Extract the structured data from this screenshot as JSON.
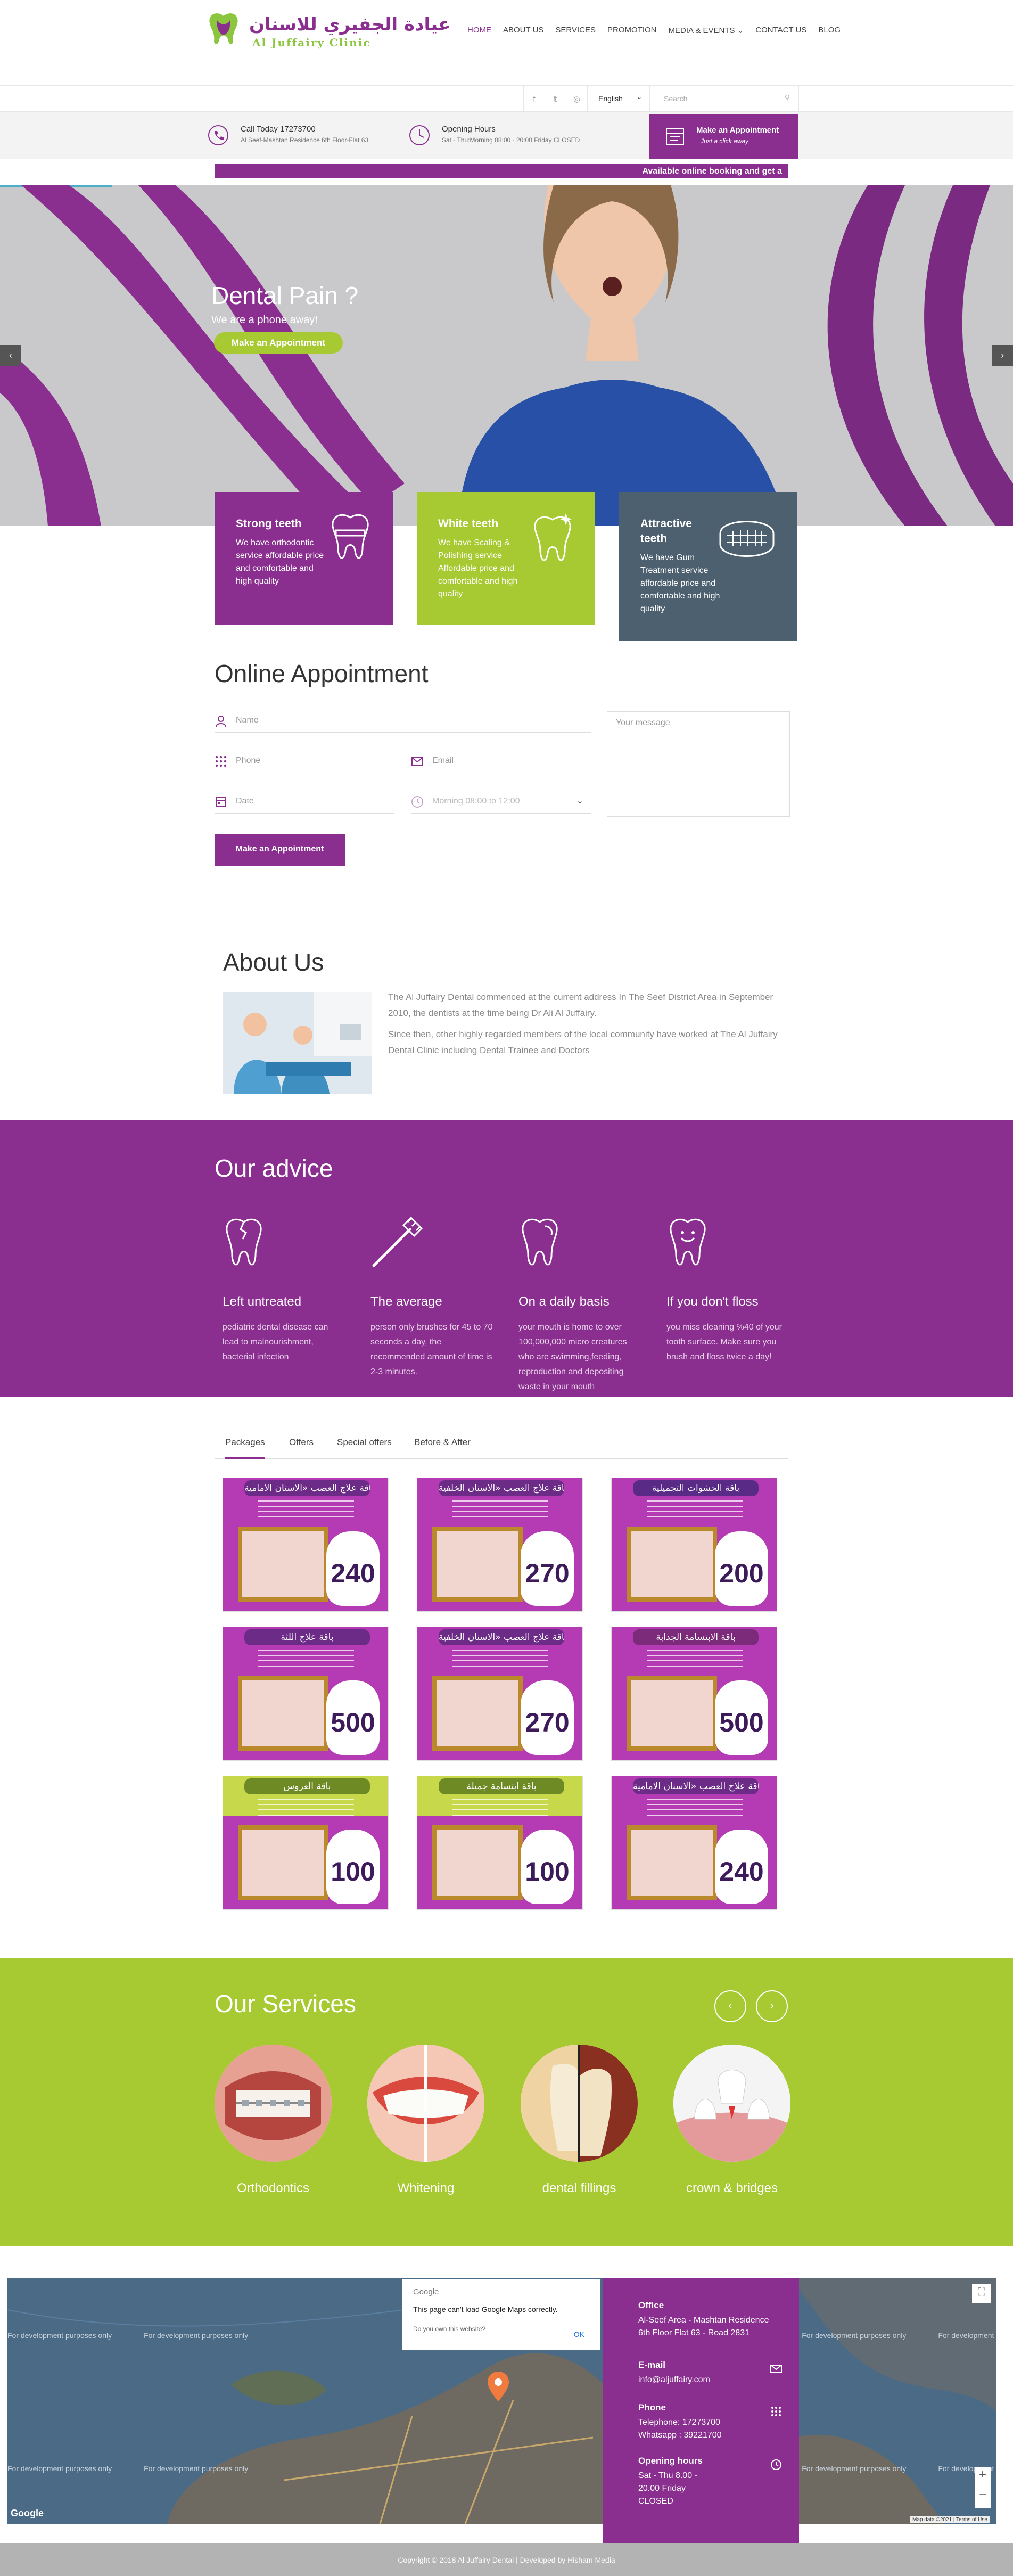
{
  "brand": {
    "logo_ar": "عيادة الجفيري للاسنان",
    "logo_en": "Al Juffairy Clinic"
  },
  "nav": [
    "HOME",
    "ABOUT US",
    "SERVICES",
    "PROMOTION",
    "MEDIA & EVENTS ⌄",
    "CONTACT US",
    "BLOG"
  ],
  "toolbar": {
    "language": "English",
    "search_placeholder": "Search"
  },
  "info": {
    "call_title": "Call Today 17273700",
    "call_sub": "Al Seef-Mashtan Residence 6th Floor-Flat 63",
    "hours_title": "Opening Hours",
    "hours_sub": "Sat - Thu:Morning 08:00 - 20:00 Friday CLOSED",
    "appt_title": "Make an Appointment",
    "appt_sub": "Just a click away"
  },
  "marquee": "Available online booking and get a",
  "hero": {
    "title": "Dental Pain ?",
    "subtitle": "We are a phone away!",
    "button": "Make an Appointment"
  },
  "features": [
    {
      "title": "Strong teeth",
      "text": "We have orthodontic service affordable price and comfortable and high quality",
      "color": "#8a2f8f"
    },
    {
      "title": "White teeth",
      "text": "We have Scaling & Polishing service Affordable price and comfortable and high quality",
      "color": "#a7c932"
    },
    {
      "title": "Attractive teeth",
      "text": "We have Gum Treatment service affordable price and comfortable and high quality",
      "color": "#4c6070"
    }
  ],
  "appointment": {
    "title": "Online Appointment",
    "name": "Name",
    "phone": "Phone",
    "email": "Email",
    "date": "Date",
    "time": "Morning 08:00 to 12:00",
    "message": "Your message",
    "submit": "Make an Appointment"
  },
  "about": {
    "title": "About Us",
    "p1": "The Al Juffairy Dental commenced at the current address In The Seef District Area in September 2010, the dentists at the time being Dr Ali Al Juffairy.",
    "p2": "Since then, other highly regarded members of the local community have worked at The Al Juffairy Dental Clinic including Dental Trainee and Doctors"
  },
  "advice": {
    "title": "Our advice",
    "items": [
      {
        "title": "Left untreated",
        "text": "pediatric dental disease can lead to malnourishment, bacterial infection"
      },
      {
        "title": "The average",
        "text": "person only brushes for 45 to 70 seconds a day, the recommended amount of time is 2-3 minutes."
      },
      {
        "title": "On a daily basis",
        "text": "your mouth is home to over 100,000,000 micro creatures who are swimming,feeding, reproduction and depositing waste in your mouth"
      },
      {
        "title": "If you don't floss",
        "text": "you miss cleaning %40 of your tooth surface. Make sure you brush and floss twice a day!"
      }
    ]
  },
  "tabs": [
    "Packages",
    "Offers",
    "Special offers",
    "Before & After"
  ],
  "packages": [
    {
      "title": "باقة علاج العصب «الاسنان الامامية»",
      "price": "240"
    },
    {
      "title": "باقة علاج العصب «الاسنان الخلفية»",
      "price": "270"
    },
    {
      "title": "باقة الحشوات التجميلية",
      "price": "200"
    },
    {
      "title": "باقة علاج اللثة",
      "price": "500"
    },
    {
      "title": "باقة علاج العصب «الاسنان الخلفية»",
      "price": "270"
    },
    {
      "title": "باقة الابتسامة الجذابة",
      "price": "500"
    },
    {
      "title": "باقة العروس",
      "price": "100"
    },
    {
      "title": "باقة ابتسامة جميلة",
      "price": "100"
    },
    {
      "title": "باقة علاج العصب «الاسنان الامامية»",
      "price": "240"
    }
  ],
  "services": {
    "title": "Our Services",
    "items": [
      "Orthodontics",
      "Whitening",
      "dental fillings",
      "crown & bridges"
    ]
  },
  "map": {
    "google": "Google",
    "error": "This page can't load Google Maps correctly.",
    "question": "Do you own this website?",
    "ok": "OK",
    "watermark": "For development purposes only",
    "attribution": "Map data ©2021 | Terms of Use"
  },
  "contact": [
    {
      "title": "Office",
      "value": "Al-Seef Area - Mashtan Residence 6th Floor Flat 63 - Road 2831"
    },
    {
      "title": "E-mail",
      "value": "info@aljuffairy.com"
    },
    {
      "title": "Phone",
      "value": "Telephone: 17273700 Whatsapp : 39221700"
    },
    {
      "title": "Opening hours",
      "value": "Sat - Thu 8.00 - 20.00 Friday CLOSED"
    }
  ],
  "footer": "Copyright © 2018 Al Juffairy Dental | Developed by Hisham Media",
  "colors": {
    "purple": "#8a2f8f",
    "green": "#a7c932",
    "slate": "#4c6070"
  }
}
